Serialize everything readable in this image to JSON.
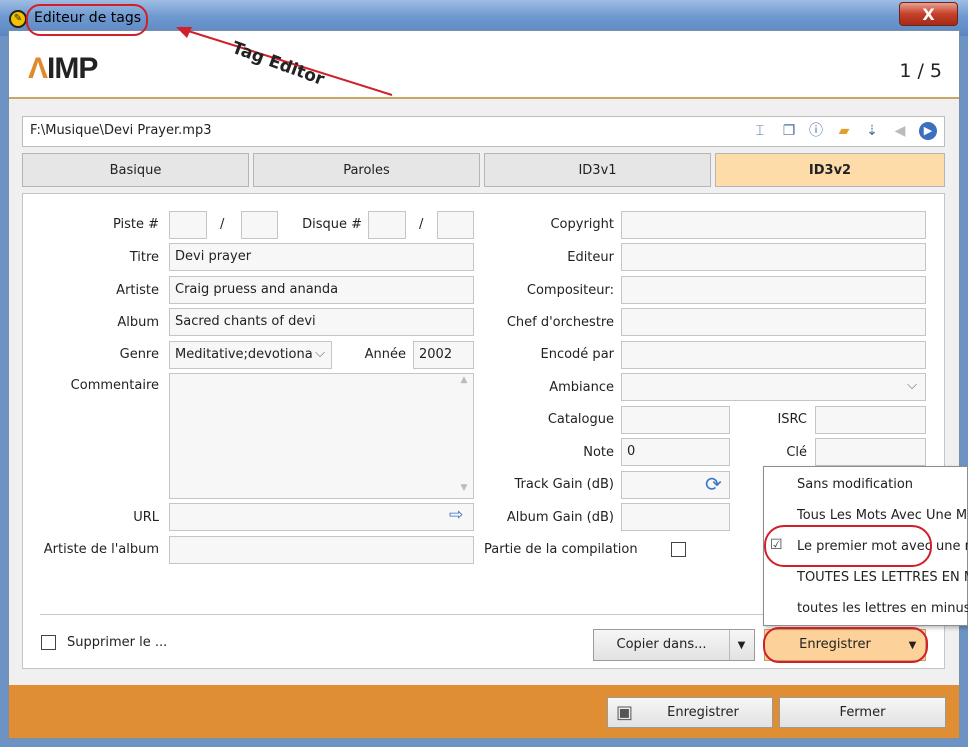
{
  "window": {
    "title": "Editeur de tags",
    "close": "X"
  },
  "header": {
    "logo": "IMP",
    "logo_mark": "Λ",
    "counter": "1 / 5"
  },
  "file": {
    "path": "F:\\Musique\\Devi Prayer.mp3",
    "icons": [
      "rename-icon",
      "copy-icon",
      "info-icon",
      "folder-search-icon",
      "export-icon",
      "back-icon",
      "forward-icon"
    ]
  },
  "tabs": [
    {
      "label": "Basique"
    },
    {
      "label": "Paroles"
    },
    {
      "label": "ID3v1"
    },
    {
      "label": "ID3v2",
      "active": true
    }
  ],
  "left": {
    "track_label": "Piste #",
    "slash": "/",
    "disc_label": "Disque #",
    "track": "",
    "track_total": "",
    "disc": "",
    "disc_total": "",
    "title_label": "Titre",
    "title": "Devi prayer",
    "artist_label": "Artiste",
    "artist": "Craig pruess and ananda",
    "album_label": "Album",
    "album": "Sacred chants of devi",
    "genre_label": "Genre",
    "genre": "Meditative;devotiona",
    "year_label": "Année",
    "year": "2002",
    "comment_label": "Commentaire",
    "comment": "",
    "url_label": "URL",
    "url": "",
    "album_artist_label": "Artiste de l'album",
    "album_artist": ""
  },
  "right": {
    "copyright_label": "Copyright",
    "publisher_label": "Editeur",
    "composer_label": "Compositeur:",
    "conductor_label": "Chef d'orchestre",
    "encoded_label": "Encodé par",
    "mood_label": "Ambiance",
    "catalog_label": "Catalogue",
    "isrc_label": "ISRC",
    "rating_label": "Note",
    "rating": "0",
    "key_label": "Clé",
    "track_gain_label": "Track Gain (dB)",
    "album_gain_label": "Album Gain (dB)",
    "compilation_label": "Partie de la compilation",
    "compilation": false
  },
  "footer": {
    "delete_label": "Supprimer le ...",
    "copy_to": "Copier dans...",
    "save_split": "Enregistrer",
    "save": "Enregistrer",
    "close": "Fermer"
  },
  "case_menu": {
    "items": [
      {
        "label": "Sans modification"
      },
      {
        "label": "Tous Les Mots Avec Une Ma"
      },
      {
        "label": "Le premier mot avec une ma",
        "checked": true
      },
      {
        "label": "TOUTES LES LETTRES EN MA"
      },
      {
        "label": "toutes les lettres en minuscu"
      }
    ]
  },
  "annotation": {
    "text": "Tag Editor",
    "color": "#d0202a"
  },
  "colors": {
    "accent": "#e08e33",
    "active_tab": "#fddcaa",
    "titlebar": "#6f99cf"
  }
}
